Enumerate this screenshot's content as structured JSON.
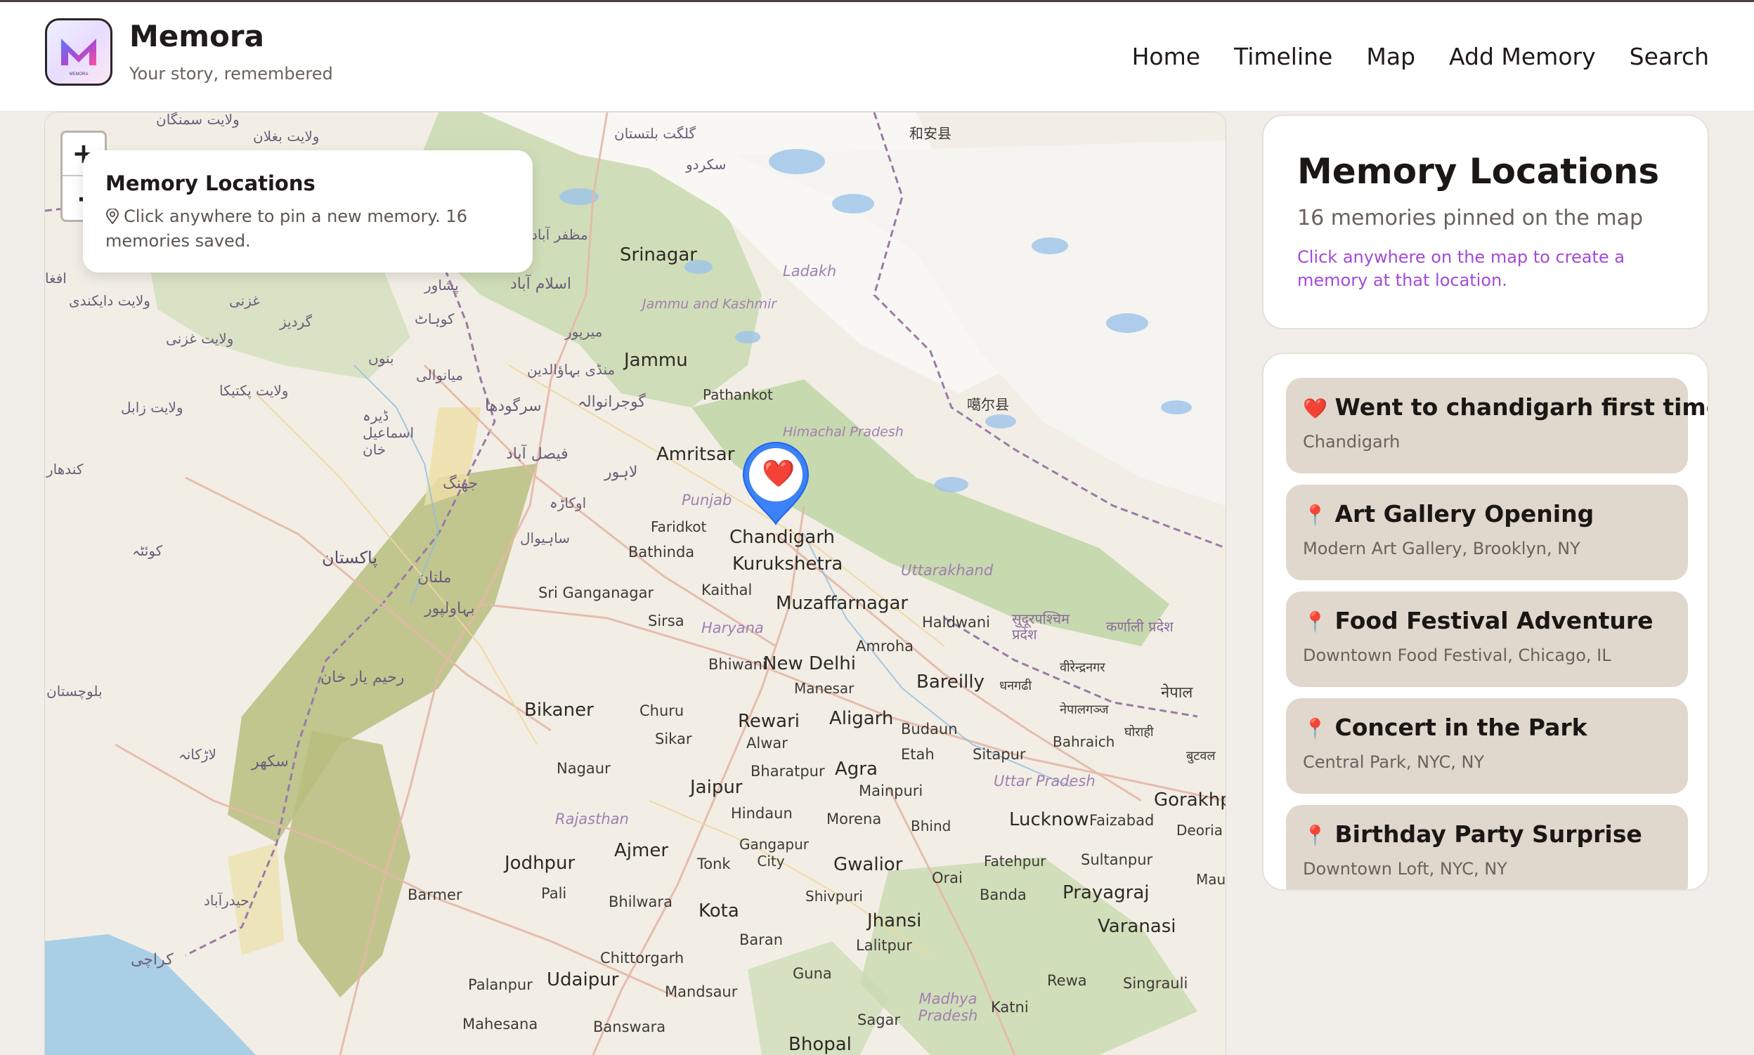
{
  "header": {
    "brand_name": "Memora",
    "brand_tagline": "Your story, remembered",
    "logo_letters": "MEMORA",
    "nav": [
      "Home",
      "Timeline",
      "Map",
      "Add Memory",
      "Search"
    ]
  },
  "map": {
    "zoom_in_label": "+",
    "zoom_out_label": "-",
    "info_card": {
      "title": "Memory Locations",
      "text": "Click anywhere to pin a new memory. 16 memories saved."
    },
    "active_marker_emoji": "❤️",
    "labels": [
      "Srinagar",
      "Jammu",
      "Ladakh",
      "Jammu and Kashmir",
      "Pathankot",
      "Amritsar",
      "Himachal Pradesh",
      "Punjab",
      "Chandigarh",
      "Faridkot",
      "Bathinda",
      "Kurukshetra",
      "Kaithal",
      "Sri Ganganagar",
      "Muzaffarnagar",
      "Uttarakhand",
      "Sirsa",
      "Haryana",
      "Haldwani",
      "Amroha",
      "Bhiwani",
      "New Delhi",
      "Bareilly",
      "Manesar",
      "Bikaner",
      "Churu",
      "Rewari",
      "Aligarh",
      "Sikar",
      "Alwar",
      "Budaun",
      "Nagaur",
      "Etah",
      "Sitapur",
      "Bharatpur",
      "Agra",
      "Jaipur",
      "Mainpuri",
      "Uttar Pradesh",
      "Hindaun",
      "Morena",
      "Bhind",
      "Lucknow",
      "Faizabad",
      "Gorakhpur",
      "Deoria",
      "Rajasthan",
      "Gangapur City",
      "Ajmer",
      "Tonk",
      "Gwalior",
      "Fatehpur",
      "Sultanpur",
      "Jodhpur",
      "Orai",
      "Barmer",
      "Pali",
      "Bhilwara",
      "Shivpuri",
      "Banda",
      "Prayagraj",
      "Kota",
      "Jhansi",
      "Varanasi",
      "Baran",
      "Lalitpur",
      "Chittorgarh",
      "Guna",
      "Rewa",
      "Singrauli",
      "Palanpur",
      "Udaipur",
      "Mandsaur",
      "Madhya Pradesh",
      "Katni",
      "Sagar",
      "Mahesana",
      "Banswara",
      "Bhopal",
      "Bahraich",
      "Mau"
    ],
    "urdu_labels": [
      "ولایت سمنگان",
      "ولایت بغلان",
      "گلگت بلتستان",
      "سکردو",
      "مظفر آباد",
      "اسلام آباد",
      "پشاور",
      "کوہاٹ",
      "میرپور",
      "منڈی بہاؤالدین",
      "گوجرانوالہ",
      "سرگودھا",
      "میانوالی",
      "فیصل آباد",
      "لاہور",
      "جھنگ",
      "اوکاڑہ",
      "ساہیوال",
      "ملتان",
      "بہاولپور",
      "رحیم یار خان",
      "پاکستان",
      "سکھر",
      "لاڑکانہ",
      "حیدرآباد",
      "کراچی",
      "بلوچستان",
      "کوئٹہ",
      "کندھار",
      "ولایت غزنی",
      "ولایت زابل",
      "ولایت پکتیکا",
      "ڈیرہ اسماعیل خان",
      "بنوں",
      "ولایت دایکندی",
      "غزنی",
      "گردیز",
      "افغا"
    ],
    "other_labels": [
      "和安县",
      "噶尔县",
      "सुदूरपश्चिम प्रदेश",
      "कर्णाली प्रदेश",
      "नेपाल",
      "धनगढी",
      "नेपालगञ्ज",
      "वीरेन्द्रनगर",
      "घोराही",
      "बुटवल"
    ]
  },
  "sidebar": {
    "summary": {
      "title": "Memory Locations",
      "count_text": "16 memories pinned on the map",
      "hint": "Click anywhere on the map to create a memory at that location."
    },
    "memories": [
      {
        "icon": "❤️",
        "icon_name": "heart-icon",
        "title": "Went to chandigarh first time",
        "location": "Chandigarh"
      },
      {
        "icon": "📍",
        "icon_name": "pin-icon",
        "title": "Art Gallery Opening",
        "location": "Modern Art Gallery, Brooklyn, NY"
      },
      {
        "icon": "📍",
        "icon_name": "pin-icon",
        "title": "Food Festival Adventure",
        "location": "Downtown Food Festival, Chicago, IL"
      },
      {
        "icon": "📍",
        "icon_name": "pin-icon",
        "title": "Concert in the Park",
        "location": "Central Park, NYC, NY"
      },
      {
        "icon": "📍",
        "icon_name": "pin-icon",
        "title": "Birthday Party Surprise",
        "location": "Downtown Loft, NYC, NY"
      }
    ]
  },
  "colors": {
    "accent_purple": "#a24bd6",
    "marker_blue": "#3b82f6",
    "card_bg": "#e0d7cd",
    "heart_red": "#e0162b"
  }
}
